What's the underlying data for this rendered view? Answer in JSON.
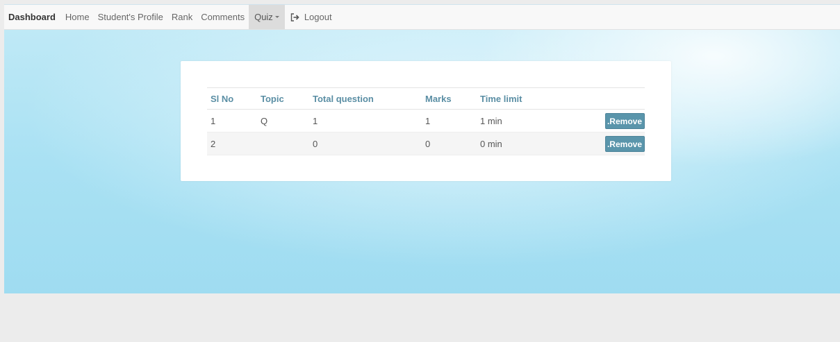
{
  "navbar": {
    "brand": "Dashboard",
    "items": [
      {
        "label": "Home"
      },
      {
        "label": "Student's Profile"
      },
      {
        "label": "Rank"
      },
      {
        "label": "Comments"
      },
      {
        "label": "Quiz"
      }
    ],
    "logout_label": "Logout",
    "logout_icon": "sign-out-icon"
  },
  "table": {
    "headers": [
      "Sl No",
      "Topic",
      "Total question",
      "Marks",
      "Time limit",
      ""
    ],
    "rows": [
      {
        "sl": "1",
        "topic": "Q",
        "total": "1",
        "marks": "1",
        "time": "1 min",
        "action": ".Remove"
      },
      {
        "sl": "2",
        "topic": "",
        "total": "0",
        "marks": "0",
        "time": "0 min",
        "action": ".Remove"
      }
    ]
  },
  "colors": {
    "accent": "#5a95ab",
    "header_text": "#5a8ea4",
    "hero": "#a9e1f3"
  }
}
